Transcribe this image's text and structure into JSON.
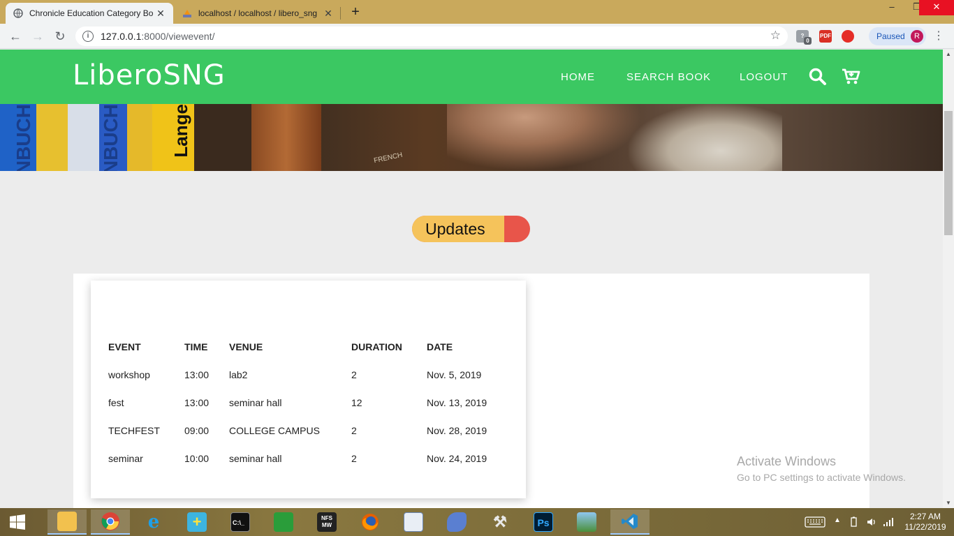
{
  "browser": {
    "tabs": [
      {
        "title": "Chronicle Education Category Bo",
        "active": true
      },
      {
        "title": "localhost / localhost / libero_sng",
        "active": false
      }
    ],
    "new_tab": "+",
    "url_host": "127.0.0.1",
    "url_path": ":8000/viewevent/",
    "profile_status": "Paused",
    "profile_initial": "R",
    "window_controls": {
      "minimize": "–",
      "maximize": "❐",
      "close": "✕"
    },
    "extension_badge": "0",
    "extension_pdf_label": "PDF"
  },
  "site": {
    "brand": "LiberoSNG",
    "nav": {
      "home": "HOME",
      "search_book": "SEARCH BOOK",
      "logout": "LOGOUT"
    },
    "hero_books": [
      "NBUCH",
      "NBUCH",
      "Lange"
    ],
    "hero_small_text": "FRENCH",
    "updates_label": "Updates",
    "table": {
      "headers": [
        "EVENT",
        "TIME",
        "VENUE",
        "DURATION",
        "DATE"
      ],
      "rows": [
        [
          "workshop",
          "13:00",
          "lab2",
          "2",
          "Nov. 5, 2019"
        ],
        [
          "fest",
          "13:00",
          "seminar hall",
          "12",
          "Nov. 13, 2019"
        ],
        [
          "TECHFEST",
          "09:00",
          "COLLEGE CAMPUS",
          "2",
          "Nov. 28, 2019"
        ],
        [
          "seminar",
          "10:00",
          "seminar hall",
          "2",
          "Nov. 24, 2019"
        ]
      ]
    },
    "colors": {
      "nav_green": "#3bc862",
      "pill_yellow": "#f5c35b",
      "pill_red": "#e8554a"
    }
  },
  "watermark": {
    "line1": "Activate Windows",
    "line2": "Go to PC settings to activate Windows."
  },
  "taskbar": {
    "apps": [
      "file-explorer",
      "chrome",
      "internet-explorer",
      "app-plus",
      "command-prompt",
      "store",
      "nfs-mw",
      "firefox",
      "document",
      "dolphin",
      "tools",
      "photoshop",
      "photo-viewer",
      "vscode"
    ],
    "icon_labels": {
      "command_prompt": "C:\\_",
      "nfs": "NFS MW",
      "photoshop": "Ps"
    },
    "time": "2:27 AM",
    "date": "11/22/2019"
  }
}
